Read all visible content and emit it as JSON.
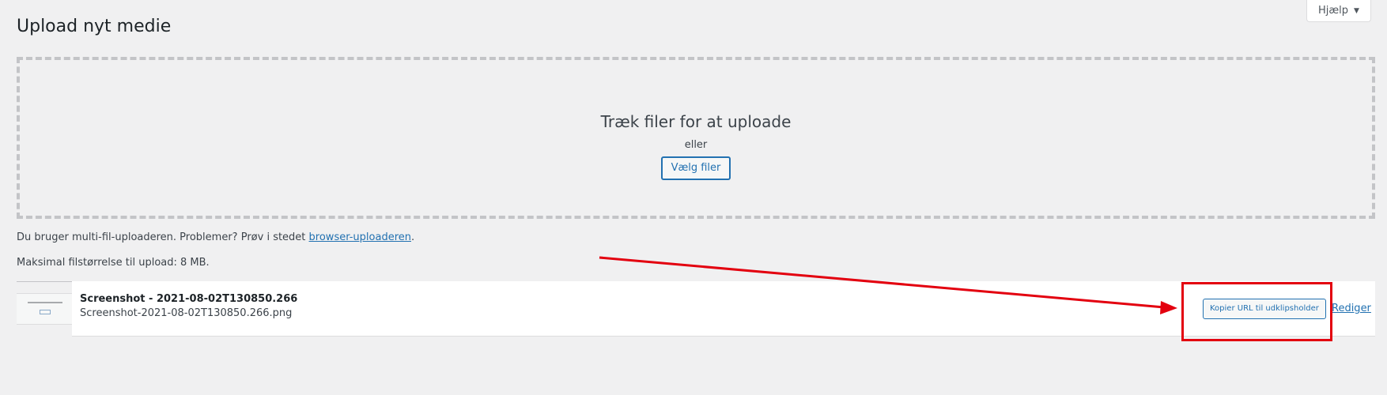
{
  "header": {
    "title": "Upload nyt medie",
    "help_label": "Hjælp",
    "help_arrow": "▼"
  },
  "uploader": {
    "drop_title": "Træk filer for at uploade",
    "or_label": "eller",
    "select_button": "Vælg filer"
  },
  "info": {
    "multi_text": "Du bruger multi-fil-uploaderen. Problemer? Prøv i stedet ",
    "browser_link": "browser-uploaderen",
    "multi_suffix": ".",
    "max_size": "Maksimal filstørrelse til upload: 8 MB."
  },
  "media_item": {
    "title": "Screenshot - 2021-08-02T130850.266",
    "filename": "Screenshot-2021-08-02T130850.266.png",
    "copy_url_button": "Kopier URL til udklipsholder",
    "edit_link": "Rediger"
  },
  "colors": {
    "background": "#f0f0f1",
    "accent": "#2271b1",
    "annotation": "#e3000f"
  }
}
